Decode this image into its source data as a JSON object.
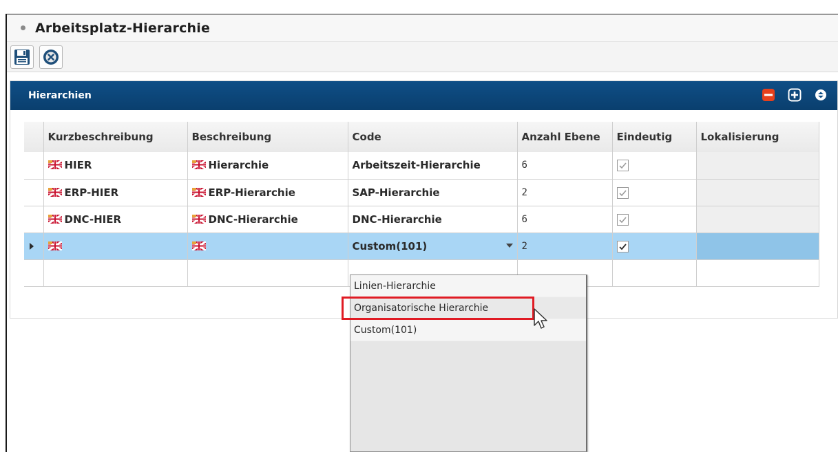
{
  "window": {
    "title": "Arbeitsplatz-Hierarchie"
  },
  "toolbar": {
    "buttons": [
      {
        "icon": "save-icon"
      },
      {
        "icon": "cancel-icon"
      }
    ]
  },
  "panel": {
    "title": "Hierarchien",
    "header_icons": [
      "remove-icon",
      "add-icon",
      "collapse-icon"
    ]
  },
  "grid": {
    "columns": [
      "Kurzbeschreibung",
      "Beschreibung",
      "Code",
      "Anzahl Ebene",
      "Eindeutig",
      "Lokalisierung"
    ],
    "rows": [
      {
        "kurz": "HIER",
        "beschreibung": "Hierarchie",
        "code": "Arbeitszeit-Hierarchie",
        "ebenen": "6",
        "eindeutig": true,
        "lokalisierung": ""
      },
      {
        "kurz": "ERP-HIER",
        "beschreibung": "ERP-Hierarchie",
        "code": "SAP-Hierarchie",
        "ebenen": "2",
        "eindeutig": true,
        "lokalisierung": ""
      },
      {
        "kurz": "DNC-HIER",
        "beschreibung": "DNC-Hierarchie",
        "code": "DNC-Hierarchie",
        "ebenen": "6",
        "eindeutig": true,
        "lokalisierung": ""
      },
      {
        "kurz": "",
        "beschreibung": "",
        "code": "Custom(101)",
        "ebenen": "2",
        "eindeutig": true,
        "lokalisierung": ""
      }
    ]
  },
  "dropdown": {
    "options": [
      "Linien-Hierarchie",
      "Organisatorische Hierarchie",
      "Custom(101)"
    ]
  },
  "colors": {
    "header_blue": "#0f4e86",
    "selected_row": "#a9d6f5",
    "highlight_red": "#e01b24"
  }
}
